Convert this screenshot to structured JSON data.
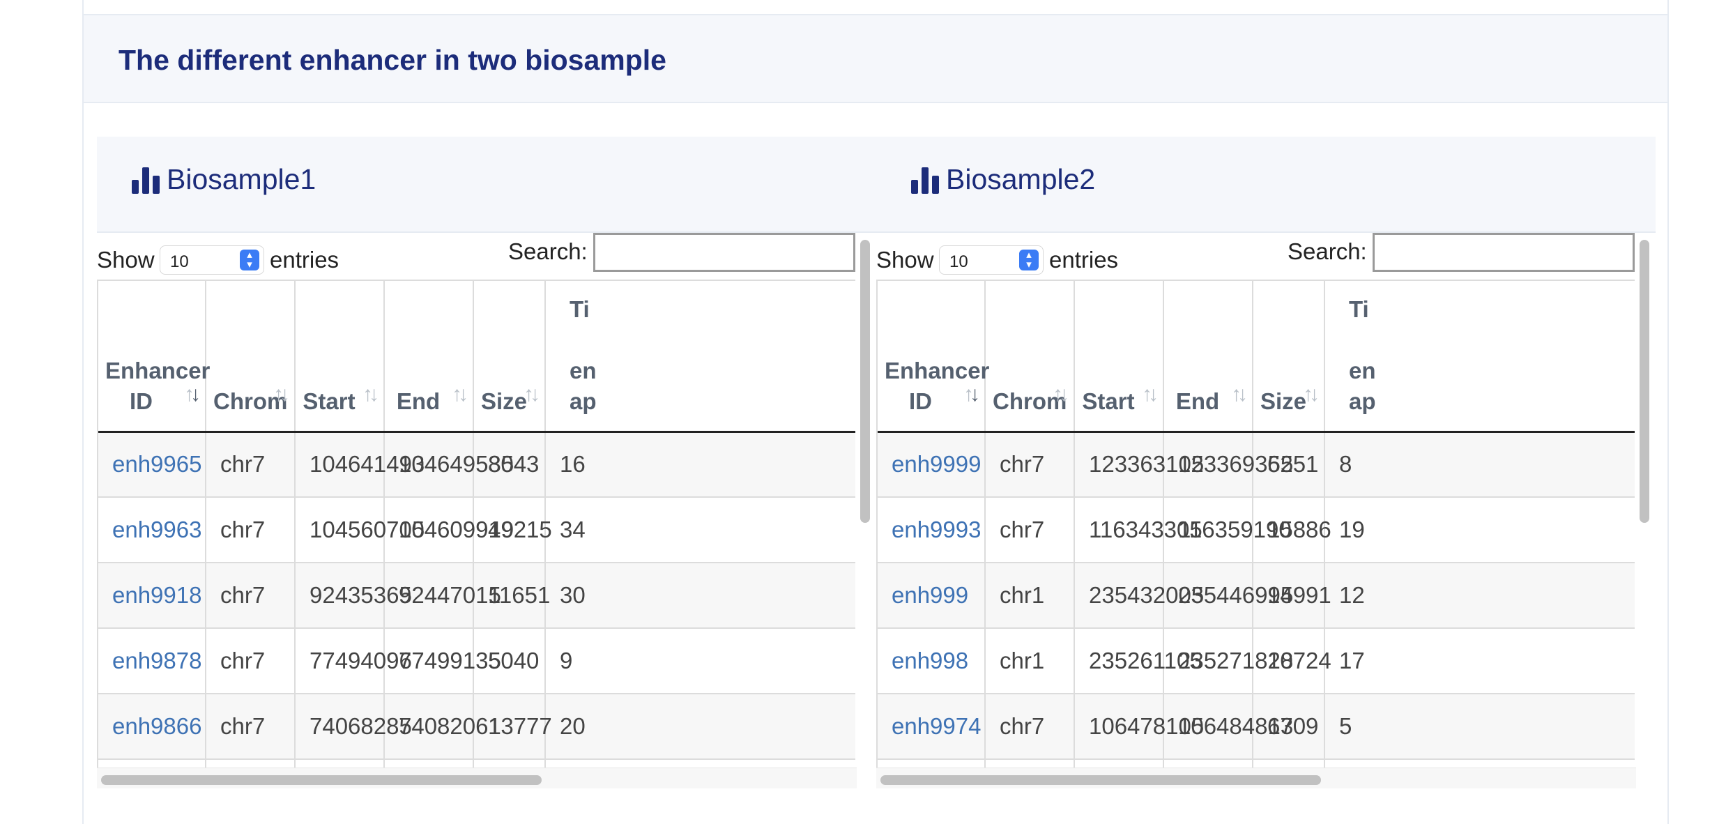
{
  "page": {
    "title": "The different enhancer in two biosample"
  },
  "controls": {
    "show_label": "Show",
    "entries_label": "entries",
    "search_label": "Search:",
    "length_value": "10"
  },
  "icons": {
    "panel_icon": "bar-chart-icon",
    "sort_icon": "sort-arrows-icon",
    "select_icon": "chevron-up-down-icon"
  },
  "colors": {
    "title": "#1c2c7a",
    "link": "#3e72b4",
    "select_accent": "#3b7cf5",
    "header_bg": "#f5f7fb"
  },
  "columns": {
    "enhancer_id": "Enhancer ID",
    "chrom": "Chrom",
    "start": "Start",
    "end": "End",
    "size": "Size",
    "tissue_top": "Ti",
    "tissue_mid": "en",
    "tissue_bot": "ap"
  },
  "panels": [
    {
      "title": "Biosample1",
      "rows": [
        [
          "enh9965",
          "chr7",
          "104641493",
          "104649535",
          "8043",
          "16"
        ],
        [
          "enh9963",
          "chr7",
          "104560705",
          "104609919",
          "49215",
          "34"
        ],
        [
          "enh9918",
          "chr7",
          "92435365",
          "92447015",
          "11651",
          "30"
        ],
        [
          "enh9878",
          "chr7",
          "77494096",
          "77499135",
          "5040",
          "9"
        ],
        [
          "enh9866",
          "chr7",
          "74068285",
          "74082061",
          "13777",
          "20"
        ]
      ]
    },
    {
      "title": "Biosample2",
      "rows": [
        [
          "enh9999",
          "chr7",
          "123363105",
          "123369355",
          "6251",
          "8"
        ],
        [
          "enh9993",
          "chr7",
          "116343305",
          "116359190",
          "15886",
          "19"
        ],
        [
          "enh999",
          "chr1",
          "235432005",
          "235446995",
          "14991",
          "12"
        ],
        [
          "enh998",
          "chr1",
          "235261105",
          "235271828",
          "10724",
          "17"
        ],
        [
          "enh9974",
          "chr7",
          "106478105",
          "106484813",
          "6709",
          "5"
        ]
      ]
    }
  ]
}
